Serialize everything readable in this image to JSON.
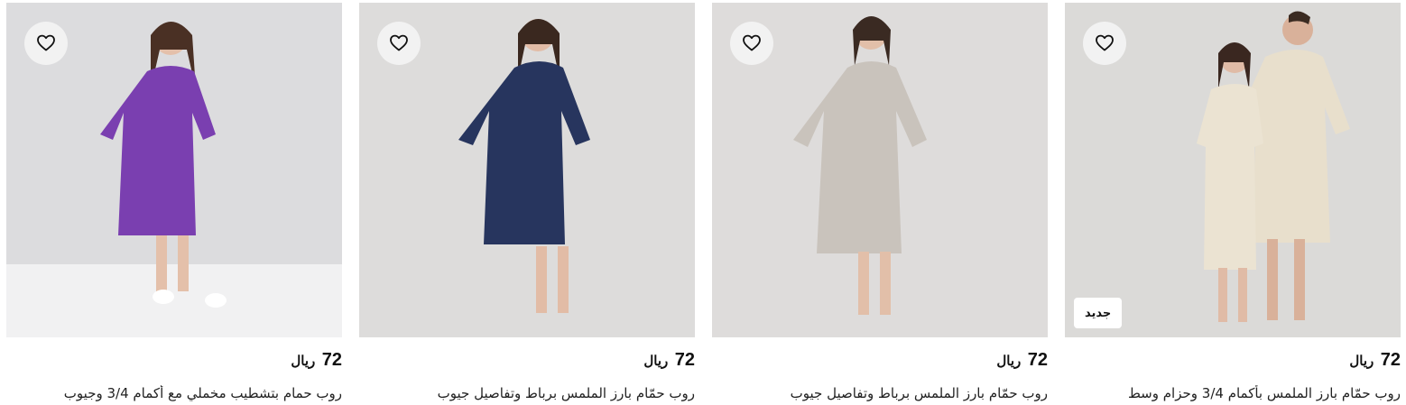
{
  "products": [
    {
      "title": "روب حمّام بارز الملمس بأكمام 3/4 وحزام وسط",
      "price_amount": "72",
      "price_currency": "ريال",
      "badge": "جديد",
      "robe_color": "#e8dfcc",
      "bg_color": "#d9d9d8"
    },
    {
      "title": "روب حمّام بارز الملمس برباط وتفاصيل جيوب",
      "price_amount": "72",
      "price_currency": "ريال",
      "robe_color": "#c9c3bc",
      "bg_color": "#dedcdb"
    },
    {
      "title": "روب حمّام بارز الملمس برباط وتفاصيل جيوب",
      "price_amount": "72",
      "price_currency": "ريال",
      "robe_color": "#27355e",
      "bg_color": "#dddcdb"
    },
    {
      "title": "روب حمام بتشطيب مخملي مع أكمام 3/4 وجيوب",
      "price_amount": "72",
      "price_currency": "ريال",
      "robe_color": "#7a3fb0",
      "bg_color": "#dcdcde"
    }
  ],
  "icons": {
    "favorite": "heart-outline-icon"
  }
}
